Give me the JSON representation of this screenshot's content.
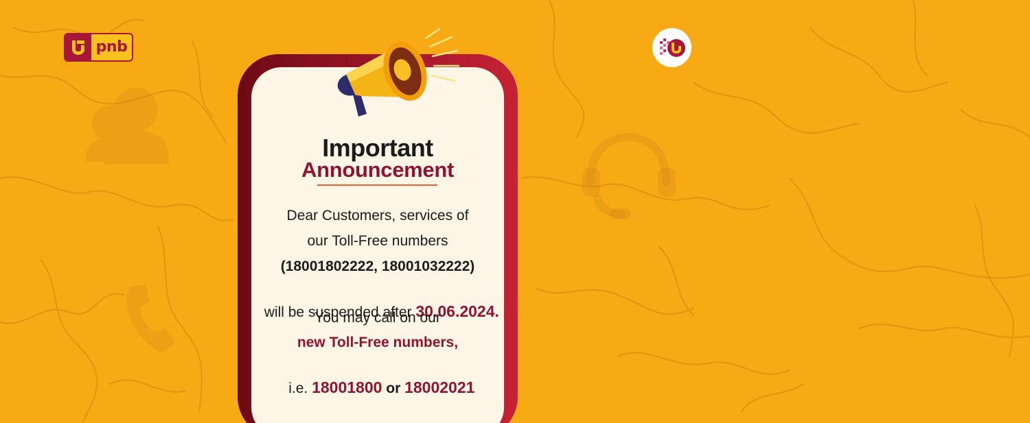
{
  "brand": {
    "logo_text": "pnb",
    "accent": "#a8173a",
    "background": "#f8aa14"
  },
  "icons": {
    "logo": "pnb-logo-icon",
    "badge": "pnb-round-badge-icon",
    "megaphone": "megaphone-icon",
    "headset": "headset-icon",
    "phone": "phone-icon",
    "support": "support-agent-icon"
  },
  "announcement": {
    "title_line1": "Important",
    "title_line2": "Announcement",
    "line1": "Dear Customers, services of",
    "line2": "our Toll-Free numbers",
    "line3": "(18001802222, 18001032222)",
    "line4_prefix": "will be suspended after ",
    "line4_date": "30.06.2024.",
    "line5": "You may call on our",
    "line6": "new Toll-Free numbers,",
    "line7_prefix": "i.e. ",
    "new_number_1": "18001800",
    "line7_or": " or ",
    "new_number_2": "18002021"
  }
}
